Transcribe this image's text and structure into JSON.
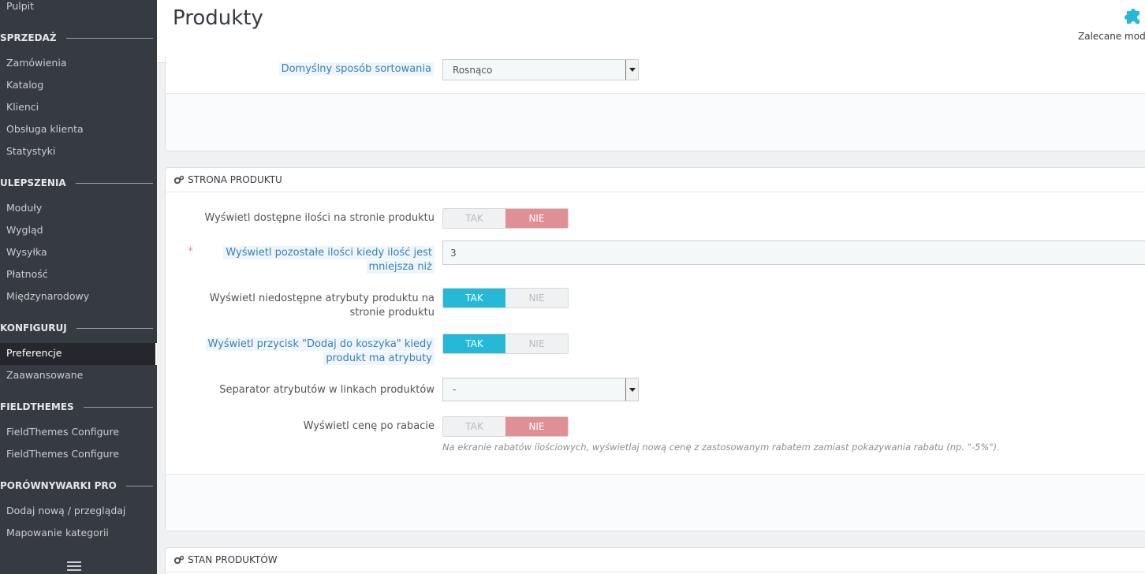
{
  "sidebar": {
    "top_item": "Pulpit",
    "sections": [
      {
        "title": "SPRZEDAŻ",
        "items": [
          "Zamówienia",
          "Katalog",
          "Klienci",
          "Obsługa klienta",
          "Statystyki"
        ]
      },
      {
        "title": "ULEPSZENIA",
        "items": [
          "Moduły",
          "Wygląd",
          "Wysyłka",
          "Płatność",
          "Międzynarodowy"
        ]
      },
      {
        "title": "KONFIGURUJ",
        "items": [
          "Preferencje",
          "Zaawansowane"
        ]
      },
      {
        "title": "FIELDTHEMES",
        "items": [
          "FieldThemes Configure",
          "FieldThemes Configure"
        ]
      },
      {
        "title": "PORÓWNYWARKI PRO",
        "items": [
          "Dodaj nową / przeglądaj",
          "Mapowanie kategorii"
        ]
      }
    ],
    "active_item": "Preferencje"
  },
  "header": {
    "title": "Produkty",
    "recommended_label": "Zalecane modu",
    "recommended_icon": "puzzle-icon",
    "accent_color": "#25b9d7"
  },
  "sorting_panel": {
    "default_order_label": "Domyślny sposób sortowania",
    "default_order_value": "Rosnąco"
  },
  "product_page_panel": {
    "heading": "STRONA PRODUKTU",
    "rows": {
      "available_qty": {
        "label": "Wyświetl dostępne ilości na stronie produktu",
        "yes": "TAK",
        "no": "NIE",
        "value": "NIE"
      },
      "remaining_qty": {
        "label": "Wyświetl pozostałe ilości kiedy ilość jest mniejsza niż",
        "required_mark": "*",
        "value": "3"
      },
      "unavailable_attrs": {
        "label": "Wyświetl niedostępne atrybuty produktu na stronie produktu",
        "yes": "TAK",
        "no": "NIE",
        "value": "TAK"
      },
      "add_to_cart": {
        "label": "Wyświetl przycisk \"Dodaj do koszyka\" kiedy produkt ma atrybuty",
        "yes": "TAK",
        "no": "NIE",
        "value": "TAK"
      },
      "attr_separator": {
        "label": "Separator atrybutów w linkach produktów",
        "value": "-"
      },
      "discounted_price": {
        "label": "Wyświetl cenę po rabacie",
        "yes": "TAK",
        "no": "NIE",
        "value": "NIE",
        "help": "Na ekranie rabatów ilościowych, wyświetlaj nową cenę z zastosowanym rabatem zamiast pokazywania rabatu (np. \"-5%\")."
      }
    }
  },
  "stock_panel": {
    "heading": "STAN PRODUKTÓW"
  }
}
